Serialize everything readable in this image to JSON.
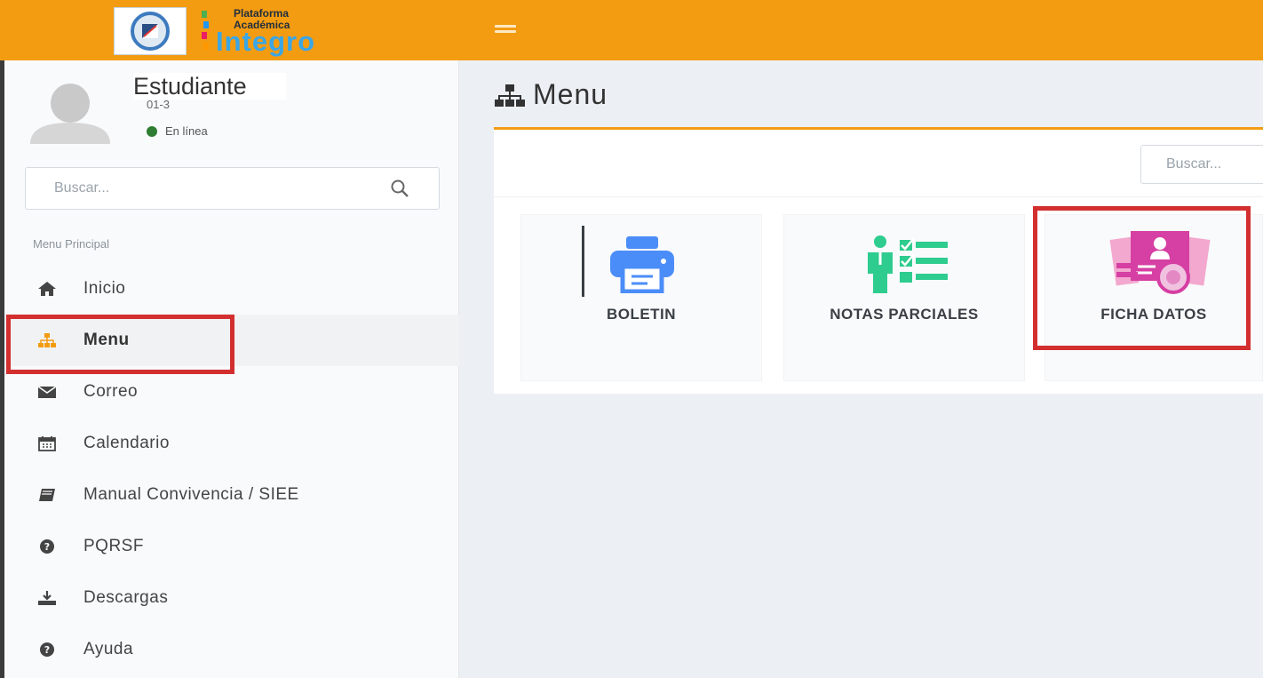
{
  "header": {
    "brand_line1": "Plataforma",
    "brand_line2": "Académica",
    "brand_name": "Integro"
  },
  "user": {
    "name": "Estudiante",
    "code": "01-3",
    "status": "En línea"
  },
  "sidebar": {
    "search_placeholder": "Buscar...",
    "menu_header": "Menu Principal",
    "items": [
      {
        "label": "Inicio",
        "icon": "home-icon"
      },
      {
        "label": "Menu",
        "icon": "sitemap-icon",
        "active": true
      },
      {
        "label": "Correo",
        "icon": "envelope-icon"
      },
      {
        "label": "Calendario",
        "icon": "calendar-icon"
      },
      {
        "label": "Manual Convivencia / SIEE",
        "icon": "book-icon"
      },
      {
        "label": "PQRSF",
        "icon": "question-circle-icon"
      },
      {
        "label": "Descargas",
        "icon": "download-icon"
      },
      {
        "label": "Ayuda",
        "icon": "question-circle-icon"
      }
    ]
  },
  "main": {
    "title": "Menu",
    "search_placeholder": "Buscar...",
    "tiles": [
      {
        "label": "BOLETIN",
        "icon": "printer-icon"
      },
      {
        "label": "NOTAS PARCIALES",
        "icon": "student-grades-icon"
      },
      {
        "label": "FICHA DATOS",
        "icon": "data-sheet-icon"
      }
    ]
  },
  "colors": {
    "accent": "#f39c12",
    "highlight": "#d32f2f",
    "status_online": "#2e7d32"
  }
}
